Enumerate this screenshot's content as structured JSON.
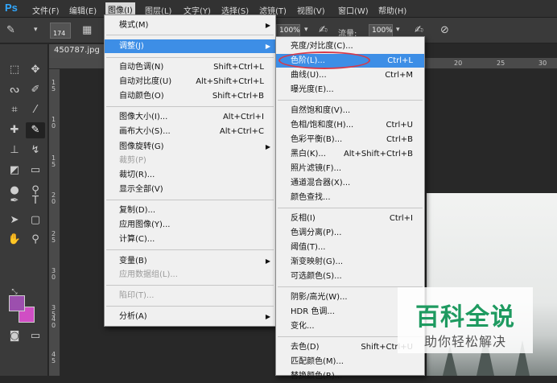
{
  "app": {
    "logo": "Ps"
  },
  "menubar": {
    "items": [
      "文件(F)",
      "编辑(E)",
      "图像(I)",
      "图层(L)",
      "文字(Y)",
      "选择(S)",
      "滤镜(T)",
      "视图(V)",
      "窗口(W)",
      "帮助(H)"
    ],
    "active": "图像(I)"
  },
  "options": {
    "brush_size": "174",
    "opacity_value": "100%",
    "flow_label": "流量:",
    "flow_value": "100%"
  },
  "document": {
    "tab_title": "450787.jpg",
    "ruler_top": [
      "20",
      "25",
      "30"
    ],
    "ruler_left": [
      "1",
      "5",
      "1",
      "0",
      "1",
      "5",
      "2",
      "0",
      "2",
      "5",
      "3",
      "0",
      "3",
      "5",
      "4",
      "0",
      "4",
      "5",
      "2",
      "5"
    ]
  },
  "image_menu": {
    "items": [
      {
        "label": "模式(M)",
        "submenu": true
      },
      {
        "label": "调整(J)",
        "submenu": true,
        "highlight": true
      },
      {
        "label": "自动色调(N)",
        "shortcut": "Shift+Ctrl+L"
      },
      {
        "label": "自动对比度(U)",
        "shortcut": "Alt+Shift+Ctrl+L"
      },
      {
        "label": "自动颜色(O)",
        "shortcut": "Shift+Ctrl+B"
      },
      {
        "label": "图像大小(I)...",
        "shortcut": "Alt+Ctrl+I"
      },
      {
        "label": "画布大小(S)...",
        "shortcut": "Alt+Ctrl+C"
      },
      {
        "label": "图像旋转(G)",
        "submenu": true
      },
      {
        "label": "裁剪(P)",
        "disabled": true
      },
      {
        "label": "裁切(R)..."
      },
      {
        "label": "显示全部(V)"
      },
      {
        "label": "复制(D)..."
      },
      {
        "label": "应用图像(Y)..."
      },
      {
        "label": "计算(C)..."
      },
      {
        "label": "变量(B)",
        "submenu": true
      },
      {
        "label": "应用数据组(L)...",
        "disabled": true
      },
      {
        "label": "陷印(T)...",
        "disabled": true
      },
      {
        "label": "分析(A)",
        "submenu": true
      }
    ]
  },
  "adjust_menu": {
    "items": [
      {
        "label": "亮度/对比度(C)..."
      },
      {
        "label": "色阶(L)...",
        "shortcut": "Ctrl+L",
        "highlight": true
      },
      {
        "label": "曲线(U)...",
        "shortcut": "Ctrl+M"
      },
      {
        "label": "曝光度(E)..."
      },
      {
        "label": "自然饱和度(V)..."
      },
      {
        "label": "色相/饱和度(H)...",
        "shortcut": "Ctrl+U"
      },
      {
        "label": "色彩平衡(B)...",
        "shortcut": "Ctrl+B"
      },
      {
        "label": "黑白(K)...",
        "shortcut": "Alt+Shift+Ctrl+B"
      },
      {
        "label": "照片滤镜(F)..."
      },
      {
        "label": "通道混合器(X)..."
      },
      {
        "label": "颜色查找..."
      },
      {
        "label": "反相(I)",
        "shortcut": "Ctrl+I"
      },
      {
        "label": "色调分离(P)..."
      },
      {
        "label": "阈值(T)..."
      },
      {
        "label": "渐变映射(G)..."
      },
      {
        "label": "可选颜色(S)..."
      },
      {
        "label": "阴影/高光(W)..."
      },
      {
        "label": "HDR 色调..."
      },
      {
        "label": "变化..."
      },
      {
        "label": "去色(D)",
        "shortcut": "Shift+Ctrl+U"
      },
      {
        "label": "匹配颜色(M)..."
      },
      {
        "label": "替换颜色(R)..."
      }
    ]
  },
  "colors": {
    "foreground": "#9c4fae",
    "background": "#d04ec4",
    "highlight": "#3d8ee6",
    "oval": "#d63a4a"
  },
  "watermark": {
    "title": "百科全说",
    "subtitle": "助你轻松解决"
  }
}
